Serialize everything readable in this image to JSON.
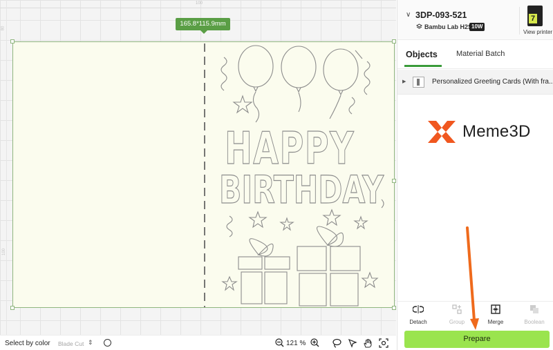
{
  "canvas": {
    "ruler_top_label": "100",
    "ruler_left_labels": [
      "80",
      "100"
    ],
    "dimension_tag": "165.8*115.9mm"
  },
  "card": {
    "headline": [
      "HAPPY",
      "BIRTHDAY"
    ]
  },
  "bottombar": {
    "select_label": "Select by color",
    "blade_label": "Blade Cut",
    "zoom": "121 %"
  },
  "panel": {
    "printer_name": "3DP-093-521",
    "printer_model": "Bambu Lab H2S",
    "nozzle_badge": "10W",
    "printer_thumb_number": "7",
    "view_printer": "View printer",
    "tabs": [
      {
        "label": "Objects",
        "active": true
      },
      {
        "label": "Material Batch",
        "active": false
      }
    ],
    "object_name": "Personalized Greeting Cards (With fra...",
    "logo_text": "Meme3D",
    "actions": [
      {
        "label": "Detach",
        "enabled": true,
        "icon": "detach-icon"
      },
      {
        "label": "Group",
        "enabled": false,
        "icon": "group-icon"
      },
      {
        "label": "Merge",
        "enabled": true,
        "icon": "merge-icon"
      },
      {
        "label": "Boolean",
        "enabled": false,
        "icon": "boolean-icon"
      }
    ],
    "prepare_label": "Prepare"
  },
  "colors": {
    "accent_green": "#9ae44e",
    "tag_green": "#5a9e45",
    "card_fill": "#fbfcee",
    "arrow_orange": "#ef6a1c",
    "logo_orange": "#f0571f"
  }
}
